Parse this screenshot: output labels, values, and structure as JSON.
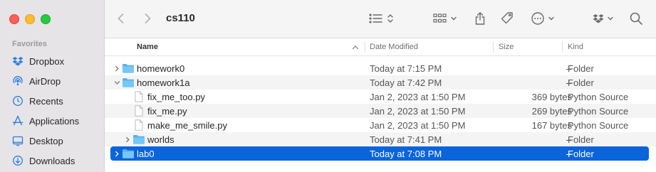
{
  "window": {
    "title": "cs110"
  },
  "sidebar": {
    "section": "Favorites",
    "items": [
      {
        "label": "Dropbox",
        "icon": "dropbox-icon"
      },
      {
        "label": "AirDrop",
        "icon": "airdrop-icon"
      },
      {
        "label": "Recents",
        "icon": "clock-icon"
      },
      {
        "label": "Applications",
        "icon": "applications-icon"
      },
      {
        "label": "Desktop",
        "icon": "desktop-icon"
      },
      {
        "label": "Downloads",
        "icon": "downloads-icon"
      }
    ]
  },
  "columns": {
    "name": "Name",
    "date": "Date Modified",
    "size": "Size",
    "kind": "Kind"
  },
  "rows": [
    {
      "name": "homework0",
      "date": "Today at 7:15 PM",
      "size": "--",
      "kind": "Folder",
      "type": "folder",
      "disclosure": "collapsed",
      "level": 0
    },
    {
      "name": "homework1a",
      "date": "Today at 7:42 PM",
      "size": "--",
      "kind": "Folder",
      "type": "folder",
      "disclosure": "expanded",
      "level": 0
    },
    {
      "name": "fix_me_too.py",
      "date": "Jan 2, 2023 at 1:50 PM",
      "size": "369 bytes",
      "kind": "Python Source",
      "type": "file",
      "disclosure": "",
      "level": 1
    },
    {
      "name": "fix_me.py",
      "date": "Jan 2, 2023 at 1:50 PM",
      "size": "269 bytes",
      "kind": "Python Source",
      "type": "file",
      "disclosure": "",
      "level": 1
    },
    {
      "name": "make_me_smile.py",
      "date": "Jan 2, 2023 at 1:50 PM",
      "size": "167 bytes",
      "kind": "Python Source",
      "type": "file",
      "disclosure": "",
      "level": 1
    },
    {
      "name": "worlds",
      "date": "Today at 7:41 PM",
      "size": "--",
      "kind": "Folder",
      "type": "folder",
      "disclosure": "collapsed",
      "level": 1
    },
    {
      "name": "lab0",
      "date": "Today at 7:08 PM",
      "size": "--",
      "kind": "Folder",
      "type": "folder",
      "disclosure": "collapsed",
      "level": 0,
      "selected": true
    }
  ]
}
